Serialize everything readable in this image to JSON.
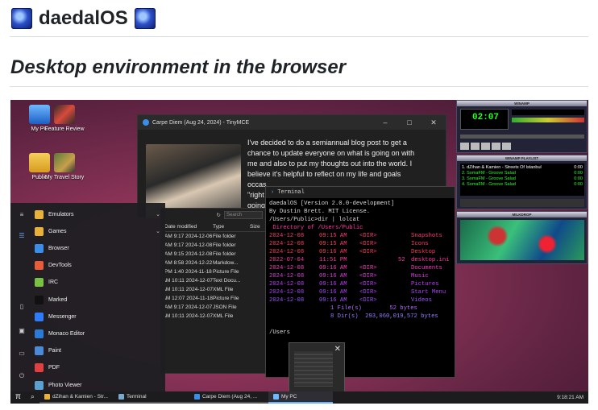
{
  "page": {
    "title": "daedalOS",
    "subtitle": "Desktop environment in the browser"
  },
  "desktop_icons": [
    {
      "label": "My PC",
      "icon": "computer-icon"
    },
    {
      "label": "Feature Review",
      "icon": "video-thumbnail-icon"
    },
    {
      "label": "Public",
      "icon": "user-folder-icon"
    },
    {
      "label": "My Travel Story",
      "icon": "video-thumbnail-icon"
    }
  ],
  "tinymce": {
    "title": "Carpe Diem (Aug 24, 2024) - TinyMCE",
    "body_lines": [
      "I've decided to do a semiannual blog post to get a",
      "chance to update everyone on what is going on with",
      "me and also to put my thoughts out into the world. I",
      "believe it's helpful to reflect on my life and goals",
      "occas",
      "\"right",
      "going"
    ]
  },
  "terminal": {
    "title": "Terminal",
    "header_lines": [
      "daedalOS [Version 2.0.0-development]",
      "By Dustin Brett. MIT License.",
      "",
      "/Users/Public>dir | lolcat",
      "",
      " Directory of /Users/Public",
      ""
    ],
    "rows": [
      {
        "date": "2024-12-08",
        "time": "09:15 AM",
        "type": "<DIR>",
        "size": "",
        "name": "Snapshots"
      },
      {
        "date": "2024-12-08",
        "time": "09:15 AM",
        "type": "<DIR>",
        "size": "",
        "name": "Icons"
      },
      {
        "date": "2024-12-08",
        "time": "09:16 AM",
        "type": "<DIR>",
        "size": "",
        "name": "Desktop"
      },
      {
        "date": "2022-07-04",
        "time": "11:51 PM",
        "type": "",
        "size": "52",
        "name": "desktop.ini"
      },
      {
        "date": "2024-12-08",
        "time": "09:16 AM",
        "type": "<DIR>",
        "size": "",
        "name": "Documents"
      },
      {
        "date": "2024-12-08",
        "time": "09:16 AM",
        "type": "<DIR>",
        "size": "",
        "name": "Music"
      },
      {
        "date": "2024-12-08",
        "time": "09:16 AM",
        "type": "<DIR>",
        "size": "",
        "name": "Pictures"
      },
      {
        "date": "2024-12-08",
        "time": "09:16 AM",
        "type": "<DIR>",
        "size": "",
        "name": "Start Menu"
      },
      {
        "date": "2024-12-08",
        "time": "09:16 AM",
        "type": "<DIR>",
        "size": "",
        "name": "Videos"
      }
    ],
    "summary_files": "1 File(s)        52 bytes",
    "summary_dirs": "8 Dir(s)  293,060,019,572 bytes",
    "prompt": "/Users"
  },
  "explorer": {
    "col_modified": "Date modified",
    "col_type": "Type",
    "col_size": "Size",
    "search_placeholder": "Search",
    "rows": [
      {
        "modified": "2024-12-06 9:17 AM",
        "type": "File folder"
      },
      {
        "modified": "2024-12-08 9:17 AM",
        "type": "File folder"
      },
      {
        "modified": "2024-12-08 9:15 AM",
        "type": "File folder"
      },
      {
        "modified": "2024-12-22 8:58 AM",
        "type": "Markdow..."
      },
      {
        "modified": "2024-11-18 1:40 PM",
        "type": "Picture File"
      },
      {
        "modified": "2024-12-07 10:11 AM",
        "type": "Text Docu..."
      },
      {
        "modified": "2024-12-07 10:11 AM",
        "type": "XML File"
      },
      {
        "modified": "2024-11-18 12:07 AM",
        "type": "Picture File"
      },
      {
        "modified": "2024-12-07 9:17 AM",
        "type": "JSON File"
      },
      {
        "modified": "2024-12-07 10:11 AM",
        "type": "XML File"
      }
    ]
  },
  "start_menu": {
    "items": [
      {
        "label": "Emulators",
        "icon": "folder-icon",
        "color": "#e8b23a",
        "chevron": true
      },
      {
        "label": "Games",
        "icon": "folder-icon",
        "color": "#e8b23a",
        "chevron": true
      },
      {
        "label": "Browser",
        "icon": "browser-icon",
        "color": "#3a8ee8"
      },
      {
        "label": "DevTools",
        "icon": "devtools-icon",
        "color": "#e85c3a"
      },
      {
        "label": "IRC",
        "icon": "irc-icon",
        "color": "#7ac143"
      },
      {
        "label": "Marked",
        "icon": "marked-icon",
        "color": "#111111"
      },
      {
        "label": "Messenger",
        "icon": "messenger-icon",
        "color": "#2f7bff"
      },
      {
        "label": "Monaco Editor",
        "icon": "monaco-editor-icon",
        "color": "#2a7ad6"
      },
      {
        "label": "Paint",
        "icon": "paint-icon",
        "color": "#4a8ad6"
      },
      {
        "label": "PDF",
        "icon": "pdf-icon",
        "color": "#e04040"
      },
      {
        "label": "Photo Viewer",
        "icon": "photo-viewer-icon",
        "color": "#5aa0d0"
      }
    ]
  },
  "winamp": {
    "main_title": "WINAMP",
    "time": "02:07",
    "playlist_title": "WINAMP PLAYLIST",
    "playlist": [
      {
        "title": "1. dZihan & Kamien - Streets Of Istanbul",
        "duration": "0:00"
      },
      {
        "title": "2. SomaFM - Groove Salad",
        "duration": "0:00"
      },
      {
        "title": "3. SomaFM - Groove Salad",
        "duration": "0:00"
      },
      {
        "title": "4. SomaFM - Groove Salad",
        "duration": "0:00"
      }
    ],
    "milkdrop_title": "MILKDROP"
  },
  "taskbar": {
    "items": [
      {
        "label": "dZihan & Kamien - Str...",
        "icon": "winamp-icon"
      },
      {
        "label": "Terminal",
        "icon": "terminal-icon"
      },
      {
        "label": "Carpe Diem (Aug 24, ...",
        "icon": "tinymce-icon"
      },
      {
        "label": "My PC",
        "icon": "computer-icon"
      }
    ],
    "clock": "9:18:21 AM"
  }
}
